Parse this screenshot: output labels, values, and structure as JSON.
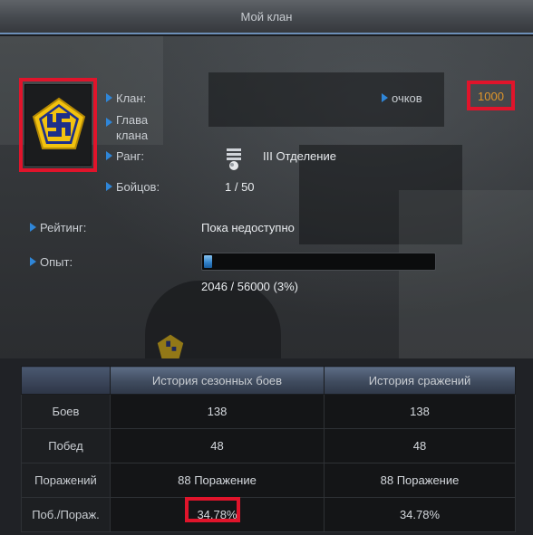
{
  "window": {
    "title": "Мой клан"
  },
  "clan": {
    "clan_label": "Клан:",
    "leader_label": "Глава клана",
    "rank_label": "Ранг:",
    "rank_value": "III Отделение",
    "fighters_label": "Бойцов:",
    "fighters_value": "1 / 50",
    "points_label": "очков",
    "points_value": "1000",
    "rating_label": "Рейтинг:",
    "rating_value": "Пока недоступно",
    "exp_label": "Опыт:",
    "exp_text": "2046 / 56000 (3%)",
    "exp_progress": 0.0365
  },
  "stats": {
    "columns": [
      "",
      "История сезонных боев",
      "История сражений"
    ],
    "rows": [
      {
        "label": "Боев",
        "season": "138",
        "battles": "138"
      },
      {
        "label": "Побед",
        "season": "48",
        "battles": "48"
      },
      {
        "label": "Поражений",
        "season": "88 Поражение",
        "battles": "88 Поражение"
      },
      {
        "label": "Поб./Пораж.",
        "season": "34.78%",
        "battles": "34.78%"
      }
    ]
  },
  "colors": {
    "accent_arrow": "#2f86d8",
    "highlight_frame": "#e0142b",
    "points_text": "#e0962a",
    "emblem_yellow": "#f2c20f",
    "emblem_blue": "#1d2f8a"
  },
  "icons": {
    "emblem": "clan-emblem-icon",
    "rank": "rank-chevron-icon",
    "bullet": "arrow-bullet-icon"
  }
}
